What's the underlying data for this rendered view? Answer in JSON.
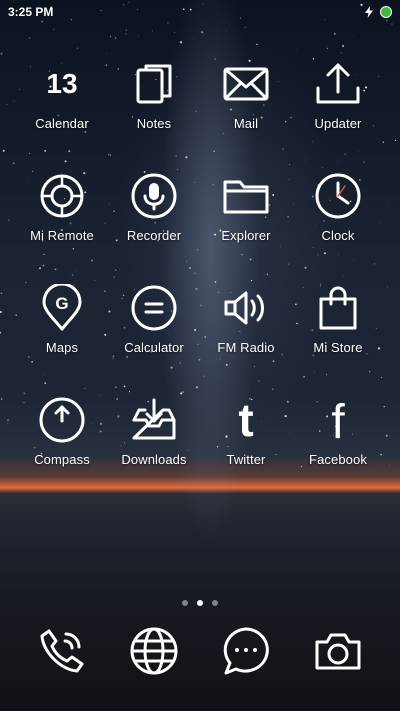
{
  "status_bar": {
    "time": "3:25 PM",
    "icons": [
      "charging-icon",
      "battery-icon"
    ],
    "battery_color": "#3dbb3d"
  },
  "home": {
    "apps": [
      {
        "label": "Calendar",
        "icon": "calendar-icon",
        "date": "13"
      },
      {
        "label": "Notes",
        "icon": "notes-icon"
      },
      {
        "label": "Mail",
        "icon": "mail-icon"
      },
      {
        "label": "Updater",
        "icon": "updater-icon"
      },
      {
        "label": "Mi Remote",
        "icon": "remote-icon"
      },
      {
        "label": "Recorder",
        "icon": "microphone-icon"
      },
      {
        "label": "Explorer",
        "icon": "folder-icon"
      },
      {
        "label": "Clock",
        "icon": "clock-icon"
      },
      {
        "label": "Maps",
        "icon": "map-pin-icon",
        "glyph": "G"
      },
      {
        "label": "Calculator",
        "icon": "calculator-icon"
      },
      {
        "label": "FM Radio",
        "icon": "speaker-icon"
      },
      {
        "label": "Mi Store",
        "icon": "shopping-bag-icon"
      },
      {
        "label": "Compass",
        "icon": "compass-icon"
      },
      {
        "label": "Downloads",
        "icon": "download-tray-icon"
      },
      {
        "label": "Twitter",
        "icon": "twitter-icon",
        "glyph": "t"
      },
      {
        "label": "Facebook",
        "icon": "facebook-icon",
        "glyph": "f"
      }
    ],
    "page_indicator": {
      "pages": 3,
      "current": 2
    }
  },
  "dock": {
    "items": [
      "phone-icon",
      "browser-globe-icon",
      "messages-icon",
      "camera-icon"
    ]
  }
}
